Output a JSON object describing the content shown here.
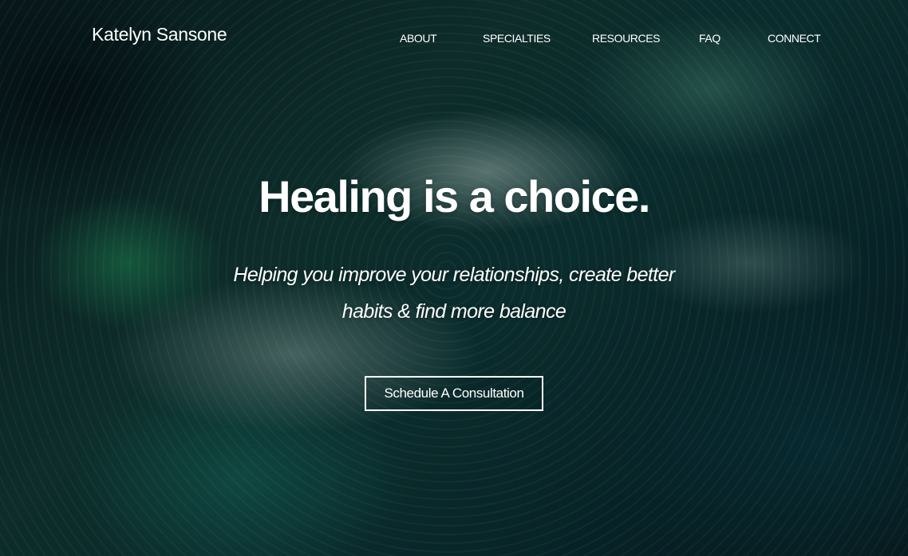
{
  "header": {
    "brand": "Katelyn Sansone",
    "nav": [
      {
        "label": "ABOUT"
      },
      {
        "label": "SPECIALTIES"
      },
      {
        "label": "RESOURCES"
      },
      {
        "label": "FAQ"
      },
      {
        "label": "CONNECT"
      }
    ]
  },
  "hero": {
    "headline": "Healing is a choice.",
    "subheadline": "Helping you improve your relationships, create better habits & find more balance",
    "cta_label": "Schedule A Consultation"
  },
  "colors": {
    "text": "#ffffff",
    "background": "#0f3a3a"
  }
}
